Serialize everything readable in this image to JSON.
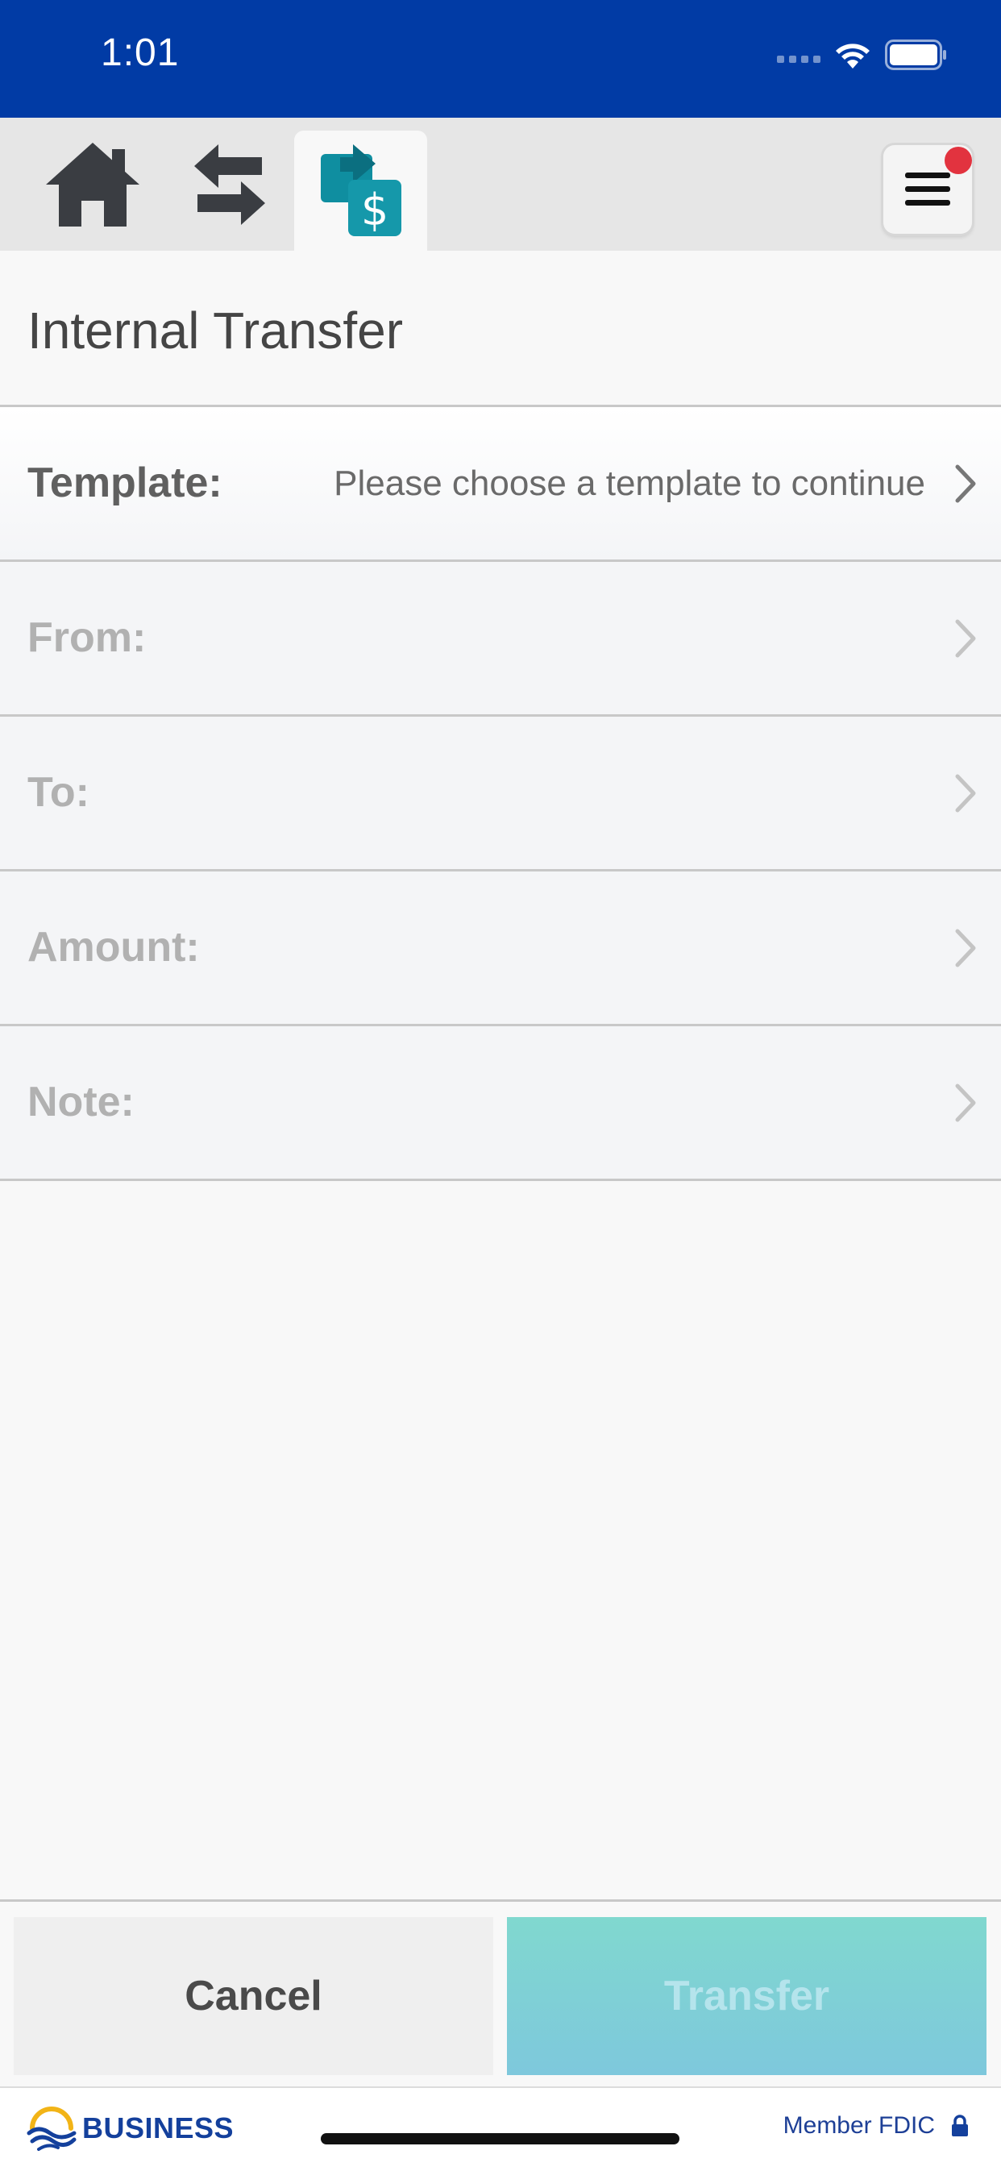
{
  "status_bar": {
    "time": "1:01",
    "icons": [
      "cellular-icon",
      "wifi-icon",
      "battery-icon"
    ]
  },
  "tabs": [
    {
      "name": "home",
      "icon": "home-icon",
      "active": false
    },
    {
      "name": "transfers",
      "icon": "swap-arrows-icon",
      "active": false
    },
    {
      "name": "internal-transfer",
      "icon": "money-transfer-icon",
      "active": true
    }
  ],
  "menu": {
    "icon": "hamburger-icon",
    "has_notification": true
  },
  "page": {
    "title": "Internal Transfer"
  },
  "form": {
    "template": {
      "label": "Template:",
      "value": "Please choose a template to continue"
    },
    "from": {
      "label": "From:",
      "value": ""
    },
    "to": {
      "label": "To:",
      "value": ""
    },
    "amount": {
      "label": "Amount:",
      "value": ""
    },
    "note": {
      "label": "Note:",
      "value": ""
    }
  },
  "buttons": {
    "cancel": "Cancel",
    "transfer": "Transfer"
  },
  "footer": {
    "brand": "BUSINESS",
    "fdic": "Member FDIC"
  },
  "colors": {
    "status_bar": "#013ba5",
    "accent_teal": "#0f8ea0",
    "transfer_button": "#80d8cf",
    "notification": "#e2333f"
  }
}
